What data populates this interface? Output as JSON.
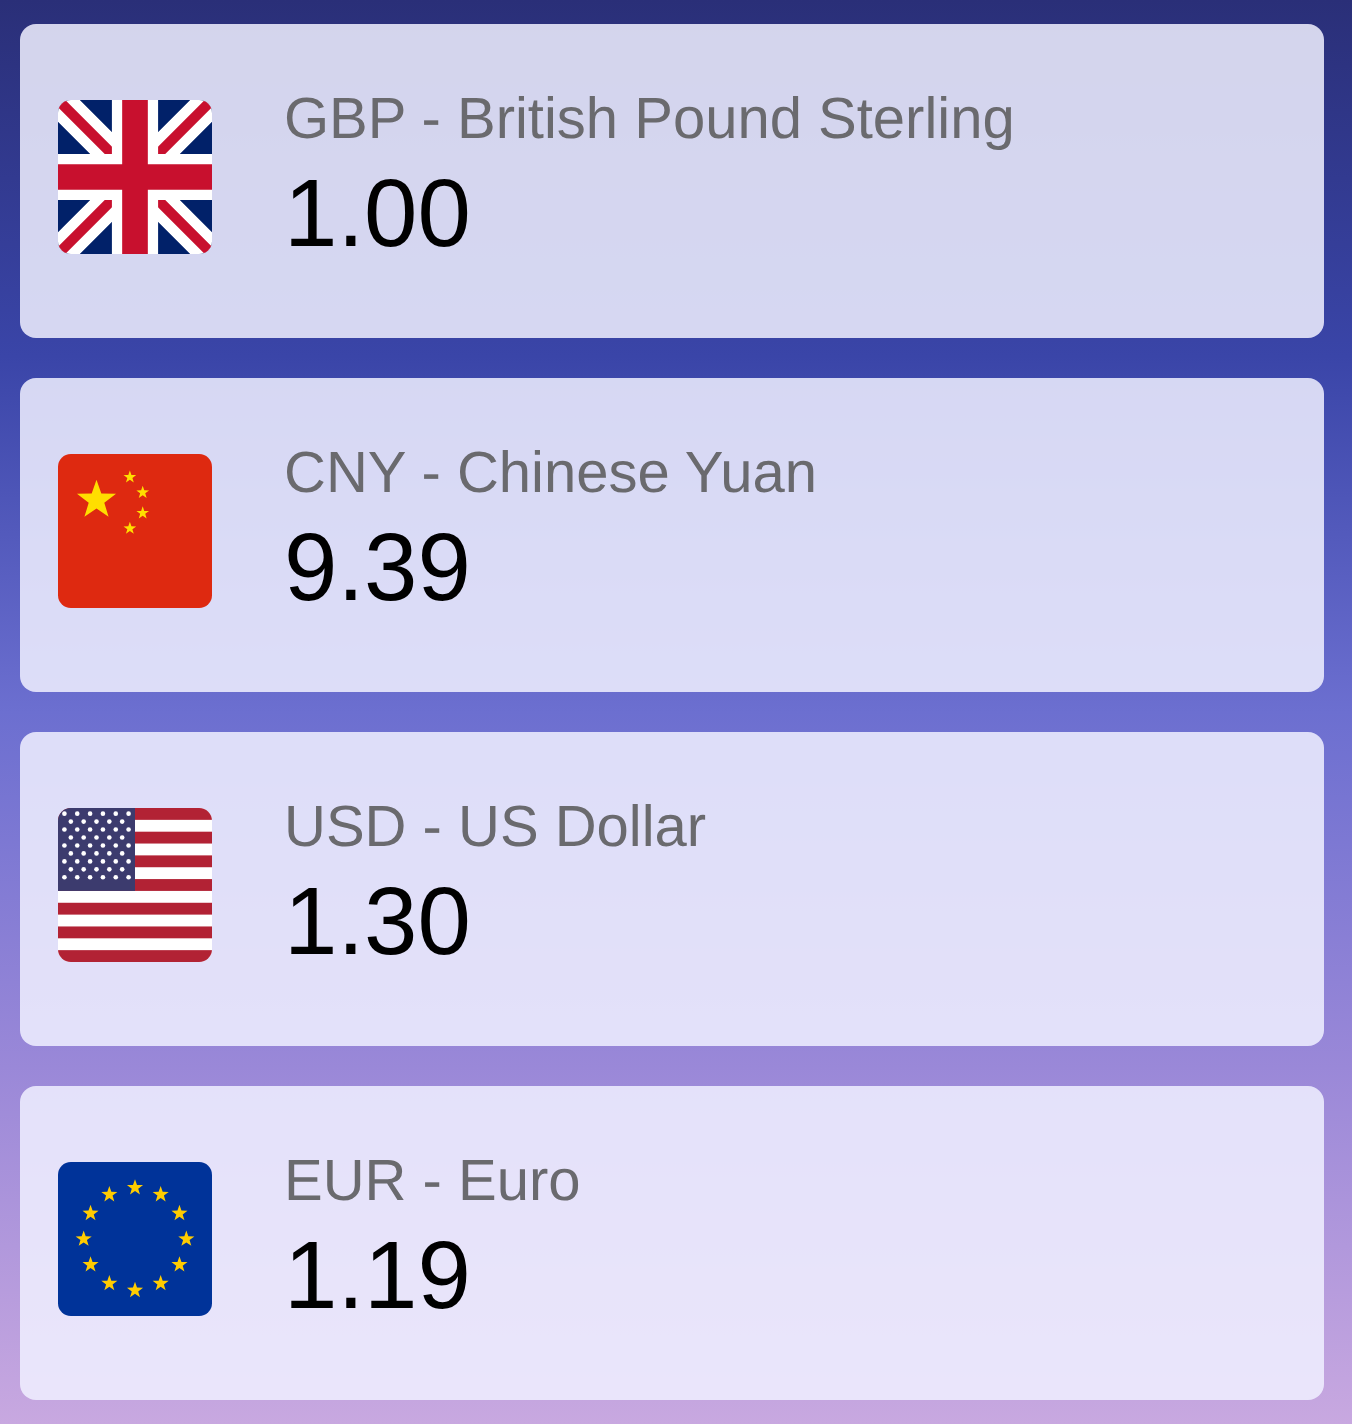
{
  "currencies": [
    {
      "kind": "gb",
      "name": "GBP - British Pound Sterling",
      "rate": "1.00"
    },
    {
      "kind": "cn",
      "name": "CNY - Chinese Yuan",
      "rate": "9.39"
    },
    {
      "kind": "us",
      "name": "USD - US Dollar",
      "rate": "1.30"
    },
    {
      "kind": "eu",
      "name": "EUR - Euro",
      "rate": "1.19"
    }
  ]
}
